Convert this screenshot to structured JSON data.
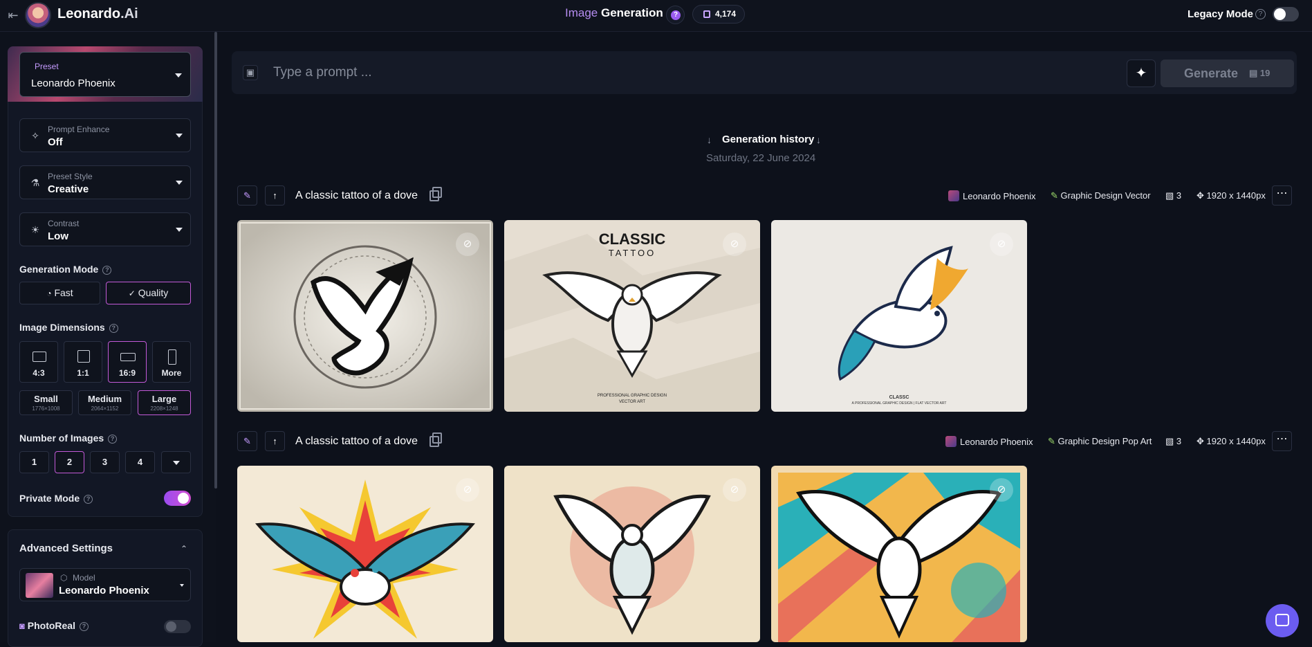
{
  "app": {
    "brand": "Leonardo",
    "brand_suffix": ".Ai"
  },
  "header": {
    "title_part1": "Image",
    "title_part2": "Generation",
    "help": "?",
    "tokens": "4,174",
    "legacy_label": "Legacy Mode",
    "legacy_help": "?"
  },
  "sidebar": {
    "preset": {
      "label": "Preset",
      "value": "Leonardo Phoenix"
    },
    "prompt_enhance": {
      "label": "Prompt Enhance",
      "value": "Off"
    },
    "preset_style": {
      "label": "Preset Style",
      "value": "Creative"
    },
    "contrast": {
      "label": "Contrast",
      "value": "Low"
    },
    "generation_mode": {
      "title": "Generation Mode",
      "fast": "Fast",
      "quality": "Quality",
      "selected": "Quality"
    },
    "image_dimensions": {
      "title": "Image Dimensions",
      "ratios": [
        "4:3",
        "1:1",
        "16:9",
        "More"
      ],
      "selected_ratio": "16:9",
      "sizes": [
        {
          "name": "Small",
          "px": "1776×1008"
        },
        {
          "name": "Medium",
          "px": "2064×1152"
        },
        {
          "name": "Large",
          "px": "2208×1248"
        }
      ],
      "selected_size": "Large"
    },
    "number_of_images": {
      "title": "Number of Images",
      "options": [
        "1",
        "2",
        "3",
        "4"
      ],
      "selected": "2"
    },
    "private_mode": {
      "label": "Private Mode",
      "on": true
    },
    "advanced": {
      "title": "Advanced Settings",
      "model_label": "Model",
      "model_value": "Leonardo Phoenix"
    },
    "photoreal": {
      "label": "PhotoReal",
      "on": false
    }
  },
  "prompt": {
    "placeholder": "Type a prompt ...",
    "generate": "Generate",
    "cost": "19"
  },
  "history": {
    "title": "Generation history",
    "date": "Saturday, 22 June 2024"
  },
  "generations": [
    {
      "prompt": "A classic tattoo of a dove",
      "model": "Leonardo Phoenix",
      "style": "Graphic Design Vector",
      "count": "3",
      "size": "1920 x 1440px"
    },
    {
      "prompt": "A classic tattoo of a dove",
      "model": "Leonardo Phoenix",
      "style": "Graphic Design Pop Art",
      "count": "3",
      "size": "1920 x 1440px"
    }
  ],
  "image_text": {
    "classic": "CLASSIC",
    "tattoo": "TATTOO",
    "pro1": "PROFESSIONAL GRAPHIC DESIGN",
    "pro2": "VECTOR ART",
    "classc": "CLASSC",
    "classc_sub": "A PROFESSIONAL GRAPHIC DESIGN | FLAT VECTOR ART"
  },
  "colors": {
    "accent": "#c35ad8",
    "toggle_on": "#9a4cf0",
    "chat": "#6b5cf0"
  }
}
